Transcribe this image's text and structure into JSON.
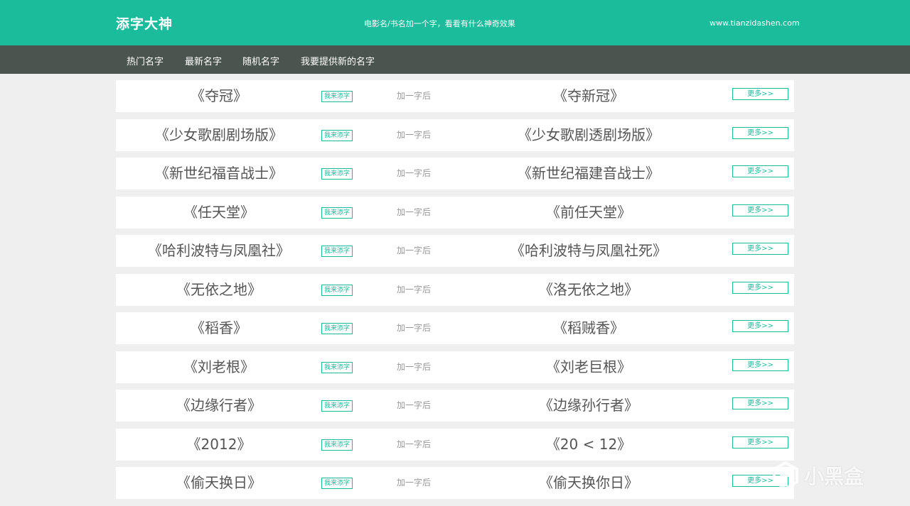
{
  "header": {
    "brand": "添字大神",
    "slogan": "电影名/书名加一个字，看看有什么神奇效果",
    "domain": "www.tianzidashen.com",
    "accent_color": "#1bbc9b"
  },
  "nav": {
    "items": [
      {
        "label": "热门名字"
      },
      {
        "label": "最新名字"
      },
      {
        "label": "随机名字"
      },
      {
        "label": "我要提供新的名字"
      }
    ]
  },
  "list": {
    "add_label": "我来添字",
    "after_label": "加一字后",
    "more_label": "更多>>",
    "rows": [
      {
        "original": "《夺冠》",
        "result": "《夺新冠》"
      },
      {
        "original": "《少女歌剧剧场版》",
        "result": "《少女歌剧透剧场版》"
      },
      {
        "original": "《新世纪福音战士》",
        "result": "《新世纪福建音战士》"
      },
      {
        "original": "《任天堂》",
        "result": "《前任天堂》"
      },
      {
        "original": "《哈利波特与凤凰社》",
        "result": "《哈利波特与凤凰社死》"
      },
      {
        "original": "《无依之地》",
        "result": "《洛无依之地》"
      },
      {
        "original": "《稻香》",
        "result": "《稻贼香》"
      },
      {
        "original": "《刘老根》",
        "result": "《刘老巨根》"
      },
      {
        "original": "《边缘行者》",
        "result": "《边缘孙行者》"
      },
      {
        "original": "《2012》",
        "result": "《20 < 12》"
      },
      {
        "original": "《偷天换日》",
        "result": "《偷天换你日》"
      }
    ]
  },
  "watermark": {
    "text": "小黑盒",
    "icon": "heybox-logo-icon"
  }
}
